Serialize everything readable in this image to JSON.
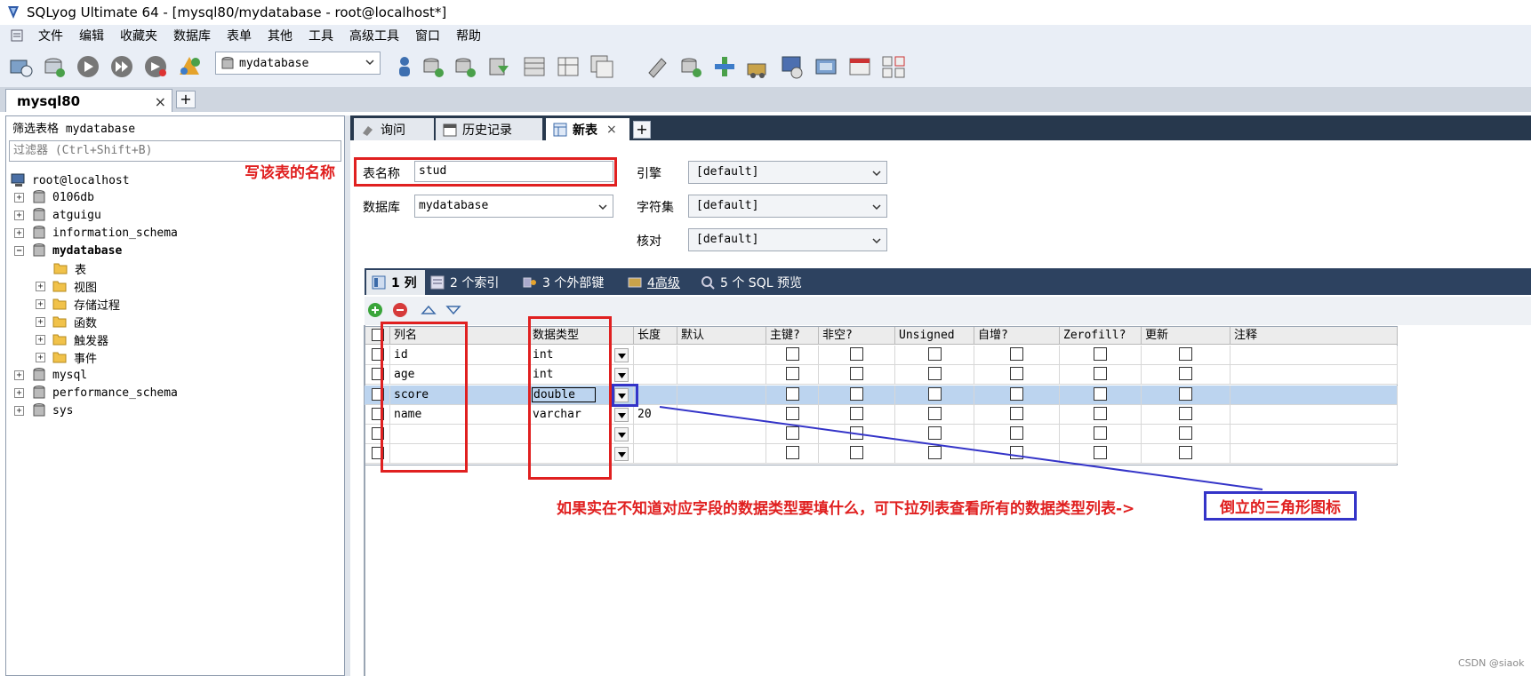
{
  "window": {
    "title": "SQLyog Ultimate 64 - [mysql80/mydatabase - root@localhost*]"
  },
  "menu": [
    "文件",
    "编辑",
    "收藏夹",
    "数据库",
    "表单",
    "其他",
    "工具",
    "高级工具",
    "窗口",
    "帮助"
  ],
  "toolbar": {
    "database_selected": "mydatabase"
  },
  "connection_tab": {
    "label": "mysql80",
    "close": "×",
    "add": "+"
  },
  "left_panel": {
    "filter_label": "筛选表格 mydatabase",
    "filter_placeholder": "过滤器 (Ctrl+Shift+B)",
    "root": "root@localhost",
    "databases": [
      "0106db",
      "atguigu",
      "information_schema",
      "mydatabase",
      "mysql",
      "performance_schema",
      "sys"
    ],
    "expanded_children": [
      "表",
      "视图",
      "存储过程",
      "函数",
      "触发器",
      "事件"
    ]
  },
  "query_tabs": {
    "query": "询问",
    "history": "历史记录",
    "new_table": "新表",
    "close": "×",
    "add": "+"
  },
  "table_form": {
    "name_label": "表名称",
    "name_value": "stud",
    "database_label": "数据库",
    "database_value": "mydatabase",
    "engine_label": "引擎",
    "engine_value": "[default]",
    "charset_label": "字符集",
    "charset_value": "[default]",
    "collation_label": "核对",
    "collation_value": "[default]"
  },
  "sub_tabs": [
    "1 列",
    "2 个索引",
    "3 个外部键",
    "4高级",
    "5 个 SQL 预览"
  ],
  "grid": {
    "headers": [
      "列名",
      "数据类型",
      "长度",
      "默认",
      "主键?",
      "非空?",
      "Unsigned",
      "自增?",
      "Zerofill?",
      "更新",
      "注释"
    ],
    "rows": [
      {
        "name": "id",
        "type": "int",
        "length": ""
      },
      {
        "name": "age",
        "type": "int",
        "length": ""
      },
      {
        "name": "score",
        "type": "double",
        "length": ""
      },
      {
        "name": "name",
        "type": "varchar",
        "length": "20"
      },
      {
        "name": "",
        "type": "",
        "length": ""
      },
      {
        "name": "",
        "type": "",
        "length": ""
      }
    ]
  },
  "annotations": {
    "table_name_note": "写该表的名称",
    "datatype_note": "如果实在不知道对应字段的数据类型要填什么，可下拉列表查看所有的数据类型列表->",
    "triangle_note": "倒立的三角形图标"
  },
  "watermark": "CSDN @siaok",
  "colors": {
    "annotation_red": "#e02020",
    "annotation_blue": "#3434c8",
    "selected_row": "#bcd4ef",
    "tab_bar": "#27384d"
  }
}
